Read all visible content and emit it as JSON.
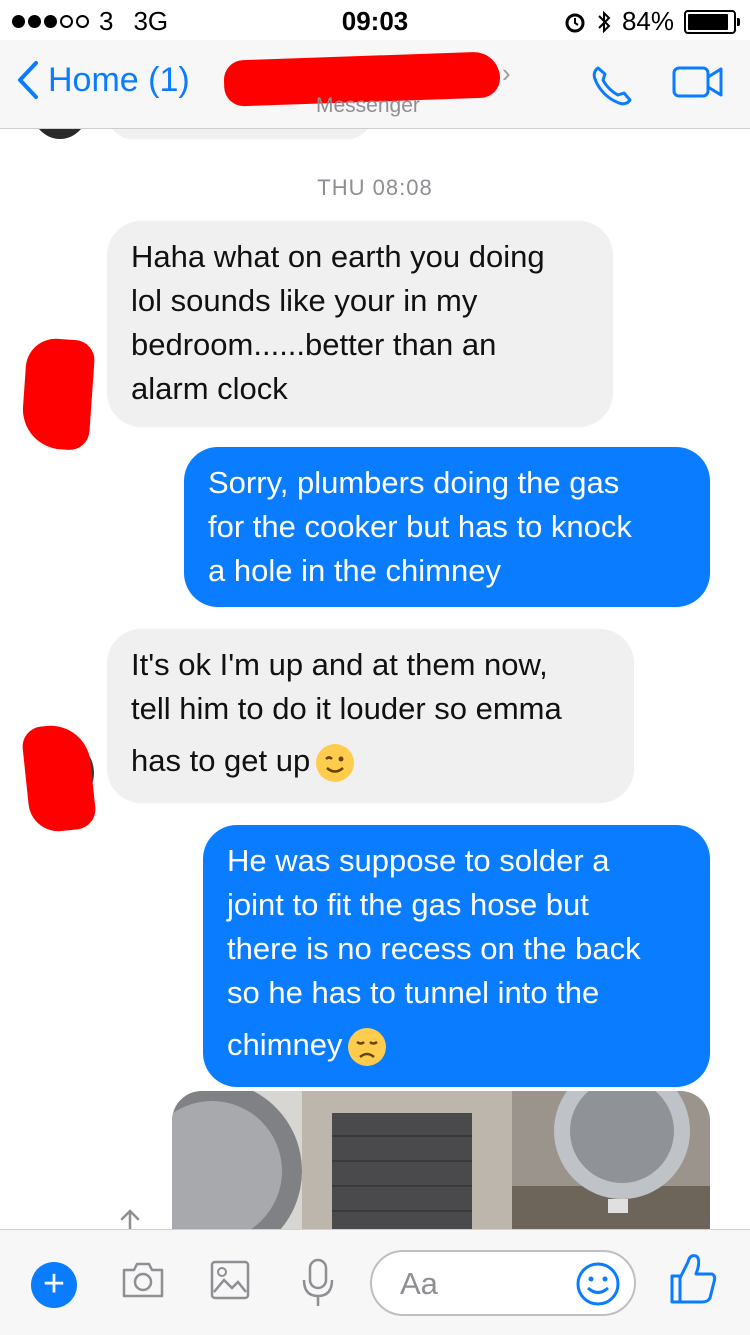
{
  "status": {
    "carrier": "3",
    "network": "3G",
    "time": "09:03",
    "battery": "84%"
  },
  "nav": {
    "back_label": "Home (1)",
    "subtitle": "Messenger"
  },
  "chat": {
    "timestamp": "THU 08:08",
    "messages": [
      {
        "direction": "in",
        "lines": [
          "Haha what on earth you doing",
          "lol sounds like your in my",
          "bedroom......better than an",
          "alarm clock"
        ]
      },
      {
        "direction": "out",
        "lines": [
          "Sorry, plumbers doing the gas",
          "for the cooker but has to knock",
          "a hole in the chimney"
        ]
      },
      {
        "direction": "in",
        "lines": [
          "It's ok I'm up and at them now,",
          "tell him to do it louder so emma",
          "has to get up"
        ],
        "emoji": "winking-face"
      },
      {
        "direction": "out",
        "lines": [
          "He was suppose to solder a",
          "joint to fit the gas hose but",
          "there is no recess on the back",
          "so he has to tunnel into the",
          "chimney"
        ],
        "emoji": "disappointed-face"
      }
    ]
  },
  "composer": {
    "placeholder": "Aa"
  },
  "colors": {
    "accent": "#0a7cff",
    "incoming_bubble": "#f1f0f0",
    "redaction": "#ff0000"
  }
}
